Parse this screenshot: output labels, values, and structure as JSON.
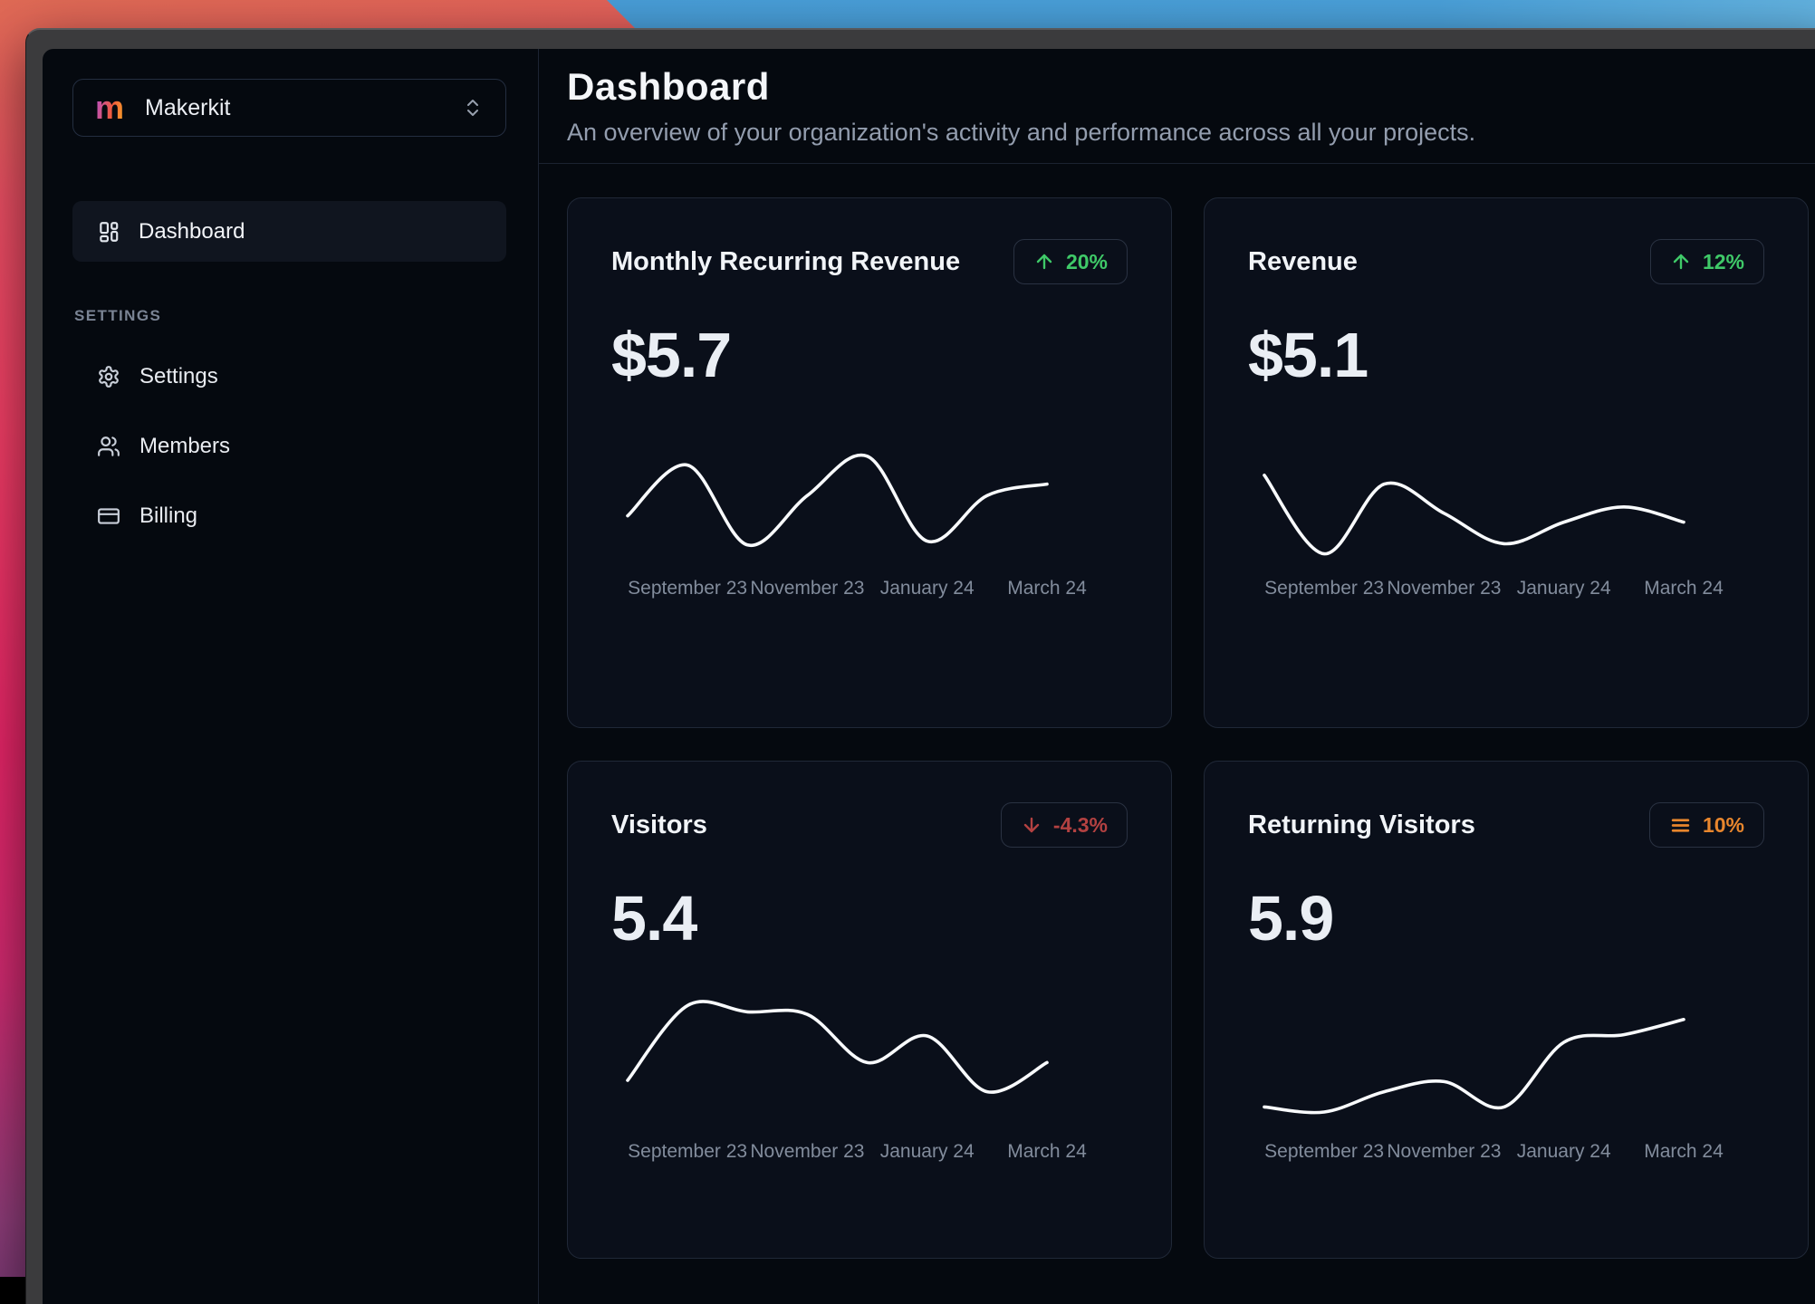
{
  "desktop": {
    "wallpaper_pink": "#e82566",
    "wallpaper_blue": "#4aa0d9",
    "window_frame_color": "#3b3b3d",
    "app_background": "#05090f"
  },
  "sidebar": {
    "team_selector": {
      "logo_letter": "m",
      "team_name": "Makerkit"
    },
    "nav": [
      {
        "label": "Dashboard",
        "icon": "layout-dashboard-icon",
        "active": true
      }
    ],
    "section_label": "SETTINGS",
    "settings_items": [
      {
        "label": "Settings",
        "icon": "gear-icon"
      },
      {
        "label": "Members",
        "icon": "users-icon"
      },
      {
        "label": "Billing",
        "icon": "credit-card-icon"
      }
    ]
  },
  "header": {
    "title": "Dashboard",
    "subtitle": "An overview of your organization's activity and performance across all your projects."
  },
  "cards": [
    {
      "title": "Monthly Recurring Revenue",
      "value": "$5.7",
      "trend": {
        "direction": "up",
        "label": "20%",
        "color": "#3fc968",
        "icon": "arrow-up-icon"
      },
      "chart": {
        "type": "line",
        "stroke": "#f8fafc",
        "x_tick_labels": [
          "September 23",
          "November 23",
          "January 24",
          "March 24"
        ],
        "values": [
          41,
          81,
          18,
          57,
          88,
          21,
          57,
          66
        ]
      }
    },
    {
      "title": "Revenue",
      "value": "$5.1",
      "trend": {
        "direction": "up",
        "label": "12%",
        "color": "#3fc968",
        "icon": "arrow-up-icon"
      },
      "chart": {
        "type": "line",
        "stroke": "#f8fafc",
        "x_tick_labels": [
          "September 23",
          "November 23",
          "January 24",
          "March 24"
        ],
        "values": [
          73,
          11,
          66,
          43,
          19,
          36,
          48,
          36
        ]
      }
    },
    {
      "title": "Visitors",
      "value": "5.4",
      "trend": {
        "direction": "down",
        "label": "-4.3%",
        "color": "#b34141",
        "icon": "arrow-down-icon"
      },
      "chart": {
        "type": "line",
        "stroke": "#f8fafc",
        "x_tick_labels": [
          "September 23",
          "November 23",
          "January 24",
          "March 24"
        ],
        "values": [
          40,
          99,
          94,
          92,
          54,
          75,
          31,
          54
        ]
      }
    },
    {
      "title": "Returning Visitors",
      "value": "5.9",
      "trend": {
        "direction": "flat",
        "label": "10%",
        "color": "#e8862d",
        "icon": "trend-flat-lines-icon"
      },
      "chart": {
        "type": "line",
        "stroke": "#f8fafc",
        "x_tick_labels": [
          "September 23",
          "November 23",
          "January 24",
          "March 24"
        ],
        "values": [
          19,
          15,
          31,
          39,
          19,
          70,
          76,
          88
        ]
      }
    }
  ]
}
